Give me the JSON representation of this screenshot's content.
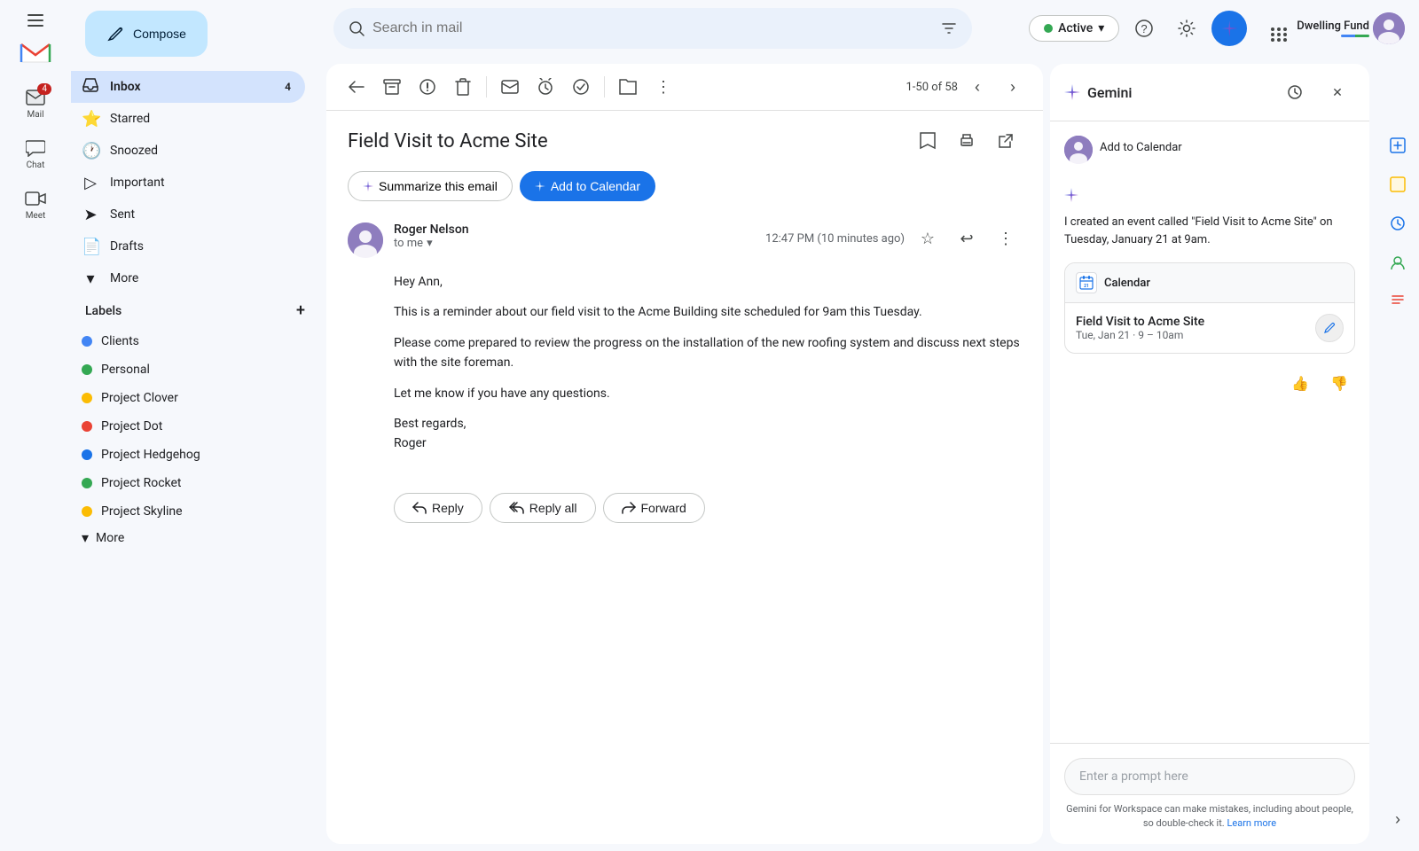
{
  "app": {
    "title": "Gmail",
    "logo_text": "Gmail"
  },
  "rail": {
    "items": [
      {
        "id": "mail",
        "label": "Mail",
        "icon": "✉",
        "badge": 4
      },
      {
        "id": "chat",
        "label": "Chat",
        "icon": "💬"
      },
      {
        "id": "meet",
        "label": "Meet",
        "icon": "📹"
      }
    ]
  },
  "sidebar": {
    "compose_label": "Compose",
    "nav_items": [
      {
        "id": "inbox",
        "label": "Inbox",
        "badge": "4",
        "active": true
      },
      {
        "id": "starred",
        "label": "Starred"
      },
      {
        "id": "snoozed",
        "label": "Snoozed"
      },
      {
        "id": "important",
        "label": "Important"
      },
      {
        "id": "sent",
        "label": "Sent"
      },
      {
        "id": "drafts",
        "label": "Drafts"
      },
      {
        "id": "more",
        "label": "More"
      }
    ],
    "labels_title": "Labels",
    "labels": [
      {
        "id": "clients",
        "label": "Clients",
        "color": "#4285f4"
      },
      {
        "id": "personal",
        "label": "Personal",
        "color": "#34a853"
      },
      {
        "id": "project-clover",
        "label": "Project Clover",
        "color": "#fbbc04"
      },
      {
        "id": "project-dot",
        "label": "Project Dot",
        "color": "#ea4335"
      },
      {
        "id": "project-hedgehog",
        "label": "Project Hedgehog",
        "color": "#1a73e8"
      },
      {
        "id": "project-rocket",
        "label": "Project Rocket",
        "color": "#34a853"
      },
      {
        "id": "project-skyline",
        "label": "Project Skyline",
        "color": "#fbbc04"
      }
    ],
    "labels_more": "More"
  },
  "topbar": {
    "search_placeholder": "Search in mail",
    "status_label": "Active",
    "help_icon": "?",
    "settings_icon": "⚙",
    "account_name": "Dwelling Fund",
    "account_bar_colors": [
      "#4285f4",
      "#34a853"
    ]
  },
  "email_toolbar": {
    "pagination": "1-50 of 58"
  },
  "email": {
    "subject": "Field Visit to Acme Site",
    "summarize_label": "Summarize this email",
    "add_to_calendar_label": "Add to Calendar",
    "sender_name": "Roger Nelson",
    "sender_to": "to me",
    "time": "12:47 PM (10 minutes ago)",
    "greeting": "Hey Ann,",
    "body_p1": "This is a reminder about our field visit to the Acme Building site scheduled for 9am this Tuesday.",
    "body_p2": "Please come prepared to review the progress on the installation of the new roofing system and discuss next steps with the site foreman.",
    "body_p3": "Let me know if you have any questions.",
    "sign_off": "Best regards,",
    "sign_name": "Roger",
    "reply_label": "Reply",
    "reply_all_label": "Reply all",
    "forward_label": "Forward"
  },
  "gemini": {
    "title": "Gemini",
    "user_action": "Add to Calendar",
    "response": "I created an event called \"Field Visit to Acme Site\" on Tuesday, January 21 at 9am.",
    "calendar_app": "Calendar",
    "event_title": "Field Visit to Acme Site",
    "event_time": "Tue, Jan 21 · 9 – 10am",
    "prompt_placeholder": "Enter a prompt here",
    "disclaimer": "Gemini for Workspace can make mistakes, including about people, so double-check it.",
    "learn_more": "Learn more"
  }
}
